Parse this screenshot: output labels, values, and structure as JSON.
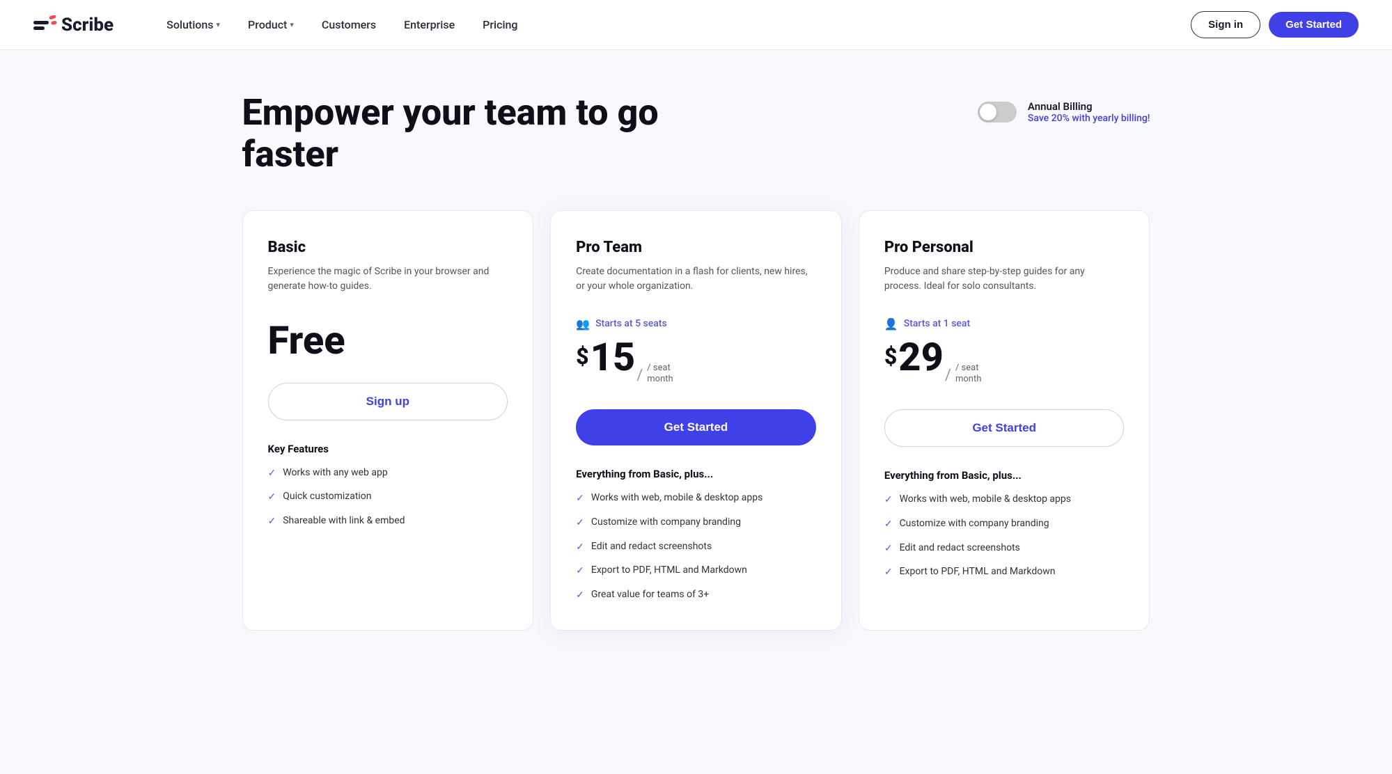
{
  "nav": {
    "logo_text": "Scribe",
    "links": [
      {
        "label": "Solutions",
        "has_dropdown": true
      },
      {
        "label": "Product",
        "has_dropdown": true
      },
      {
        "label": "Customers",
        "has_dropdown": false
      },
      {
        "label": "Enterprise",
        "has_dropdown": false
      },
      {
        "label": "Pricing",
        "has_dropdown": false
      }
    ],
    "signin_label": "Sign in",
    "getstarted_label": "Get Started"
  },
  "hero": {
    "title": "Empower your team to go faster",
    "billing_label": "Annual Billing",
    "billing_save": "Save 20% with yearly billing!"
  },
  "plans": [
    {
      "id": "basic",
      "name": "Basic",
      "description": "Experience the magic of Scribe in your browser and generate how-to guides.",
      "price_label": "Free",
      "seats_label": null,
      "cta_label": "Sign up",
      "cta_style": "outline",
      "features_heading": "Key Features",
      "features": [
        "Works with any web app",
        "Quick customization",
        "Shareable with link & embed"
      ]
    },
    {
      "id": "pro_team",
      "name": "Pro Team",
      "description": "Create documentation in a flash for clients, new hires, or your whole organization.",
      "price_dollar": "$",
      "price_amount": "15",
      "price_per_line1": "/ seat",
      "price_per_line2": "month",
      "seats_label": "Starts at 5 seats",
      "cta_label": "Get Started",
      "cta_style": "filled",
      "features_heading": "Everything from Basic, plus...",
      "features": [
        "Works with web, mobile & desktop apps",
        "Customize with company branding",
        "Edit and redact screenshots",
        "Export to PDF, HTML and Markdown",
        "Great value for teams of 3+"
      ]
    },
    {
      "id": "pro_personal",
      "name": "Pro Personal",
      "description": "Produce and share step-by-step guides for any process. Ideal for solo consultants.",
      "price_dollar": "$",
      "price_amount": "29",
      "price_per_line1": "/ seat",
      "price_per_line2": "month",
      "seats_label": "Starts at 1 seat",
      "cta_label": "Get Started",
      "cta_style": "outline",
      "features_heading": "Everything from Basic, plus...",
      "features": [
        "Works with web, mobile & desktop apps",
        "Customize with company branding",
        "Edit and redact screenshots",
        "Export to PDF, HTML and Markdown"
      ]
    }
  ],
  "icons": {
    "chevron": "▾",
    "check": "✓",
    "users": "👥",
    "user": "👤"
  },
  "colors": {
    "brand_purple": "#4040e8",
    "text_dark": "#0f0f1a",
    "text_muted": "#555555"
  }
}
